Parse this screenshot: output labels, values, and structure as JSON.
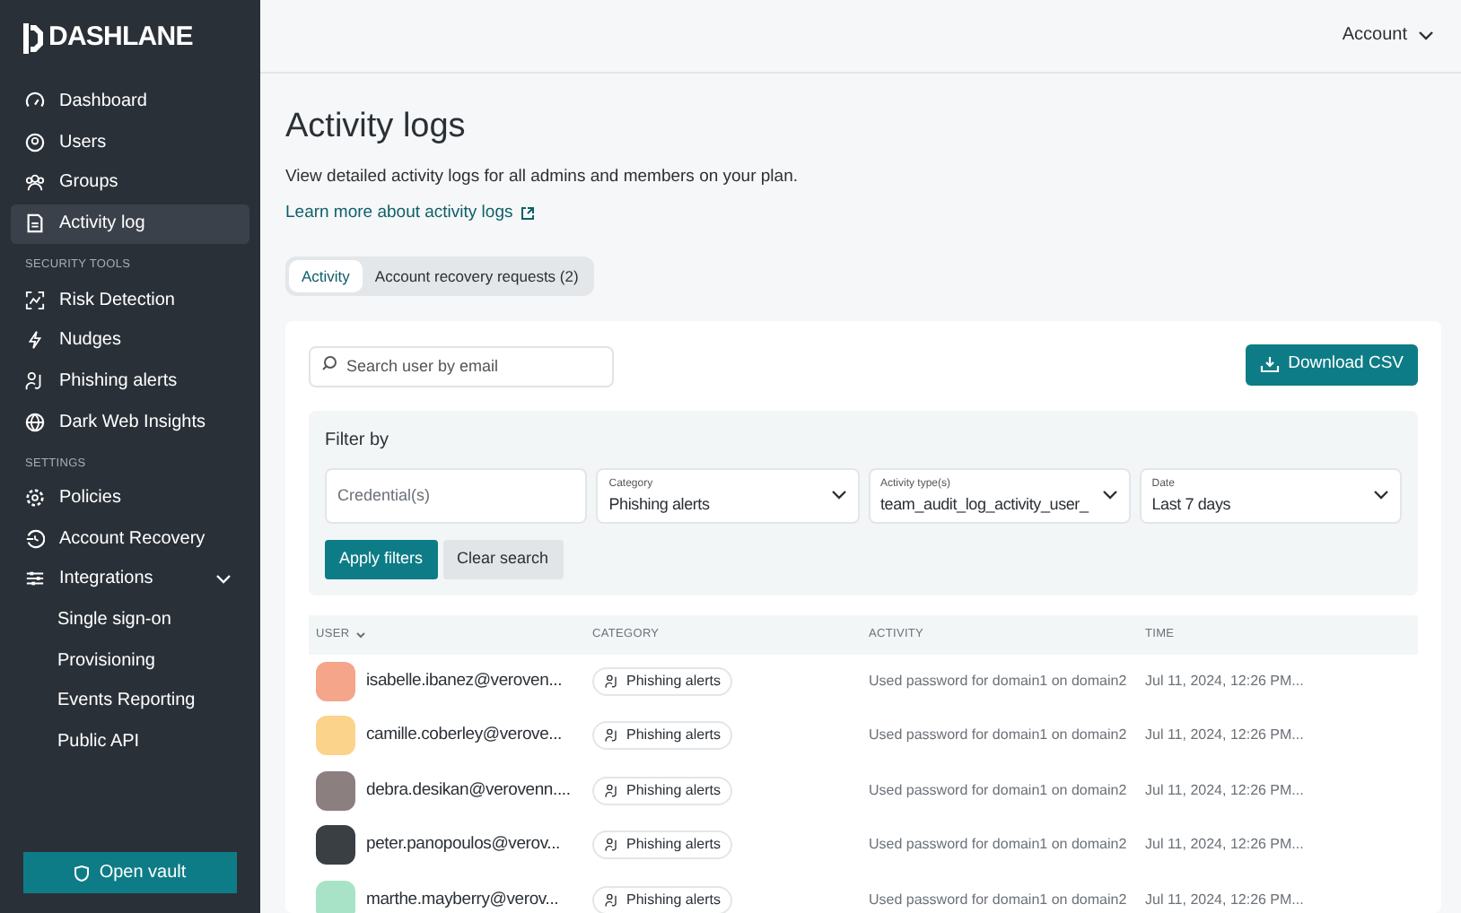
{
  "sidebar": {
    "logo": "DASHLANE",
    "sections": [
      {
        "items": [
          {
            "kind": "dashboard",
            "label": "Dashboard",
            "selected": false
          },
          {
            "kind": "users",
            "label": "Users",
            "selected": false
          },
          {
            "kind": "groups",
            "label": "Groups",
            "selected": false
          },
          {
            "kind": "doc",
            "label": "Activity log",
            "selected": true
          }
        ]
      },
      {
        "title": "SECURITY TOOLS",
        "items": [
          {
            "kind": "risk",
            "label": "Risk Detection",
            "selected": false
          },
          {
            "kind": "bolt",
            "label": "Nudges",
            "selected": false
          },
          {
            "kind": "phish",
            "label": "Phishing alerts",
            "selected": false
          },
          {
            "kind": "web",
            "label": "Dark Web Insights",
            "selected": false
          }
        ]
      },
      {
        "title": "SETTINGS",
        "items": [
          {
            "kind": "gear",
            "label": "Policies",
            "selected": false
          },
          {
            "kind": "recovery",
            "label": "Account Recovery",
            "selected": false
          },
          {
            "kind": "sliders",
            "label": "Integrations",
            "selected": false,
            "expanded": true,
            "children": [
              {
                "label": "Single sign-on",
                "selected": false
              },
              {
                "label": "Provisioning",
                "selected": false
              },
              {
                "label": "Events Reporting",
                "selected": false
              },
              {
                "label": "Public API",
                "selected": false
              }
            ]
          }
        ]
      }
    ],
    "open_vault": "Open vault"
  },
  "top_bar": {
    "account": "Account"
  },
  "page": {
    "title": "Activity logs",
    "description": "View detailed activity logs for all admins and members on your plan.",
    "learn_more": "Learn more about activity logs",
    "tabs": [
      {
        "label": "Activity",
        "selected": true
      },
      {
        "label": "Account recovery requests (2)",
        "selected": false
      }
    ]
  },
  "search": {
    "placeholder": "Search user by email"
  },
  "download_button": "Download CSV",
  "filters": {
    "title": "Filter by",
    "fields": [
      {
        "kind": "text",
        "placeholder": "Credential(s)"
      },
      {
        "kind": "select",
        "label": "Category",
        "value": "Phishing alerts"
      },
      {
        "kind": "select",
        "label": "Activity type(s)",
        "value": "team_audit_log_activity_user_"
      },
      {
        "kind": "select",
        "label": "Date",
        "value": "Last 7 days"
      }
    ],
    "apply": "Apply filters",
    "clear": "Clear search"
  },
  "table": {
    "columns": [
      "USER",
      "CATEGORY",
      "ACTIVITY",
      "TIME"
    ],
    "rows": [
      {
        "user": "isabelle.ibanez@veroven...",
        "color": "#f4a58a",
        "category": "Phishing alerts",
        "activity": "Used password for domain1 on domain2",
        "time": "Jul 11, 2024, 12:26 PM..."
      },
      {
        "user": "camille.coberley@verove...",
        "color": "#fcd38a",
        "category": "Phishing alerts",
        "activity": "Used password for domain1 on domain2",
        "time": "Jul 11, 2024, 12:26 PM..."
      },
      {
        "user": "debra.desikan@verovenn....",
        "color": "#8c7f80",
        "category": "Phishing alerts",
        "activity": "Used password for domain1 on domain2",
        "time": "Jul 11, 2024, 12:26 PM..."
      },
      {
        "user": "peter.panopoulos@verov...",
        "color": "#3a3f44",
        "category": "Phishing alerts",
        "activity": "Used password for domain1 on domain2",
        "time": "Jul 11, 2024, 12:26 PM..."
      },
      {
        "user": "marthe.mayberry@verov...",
        "color": "#a9e3c7",
        "category": "Phishing alerts",
        "activity": "Used password for domain1 on domain2",
        "time": "Jul 11, 2024, 12:26 PM..."
      }
    ]
  }
}
